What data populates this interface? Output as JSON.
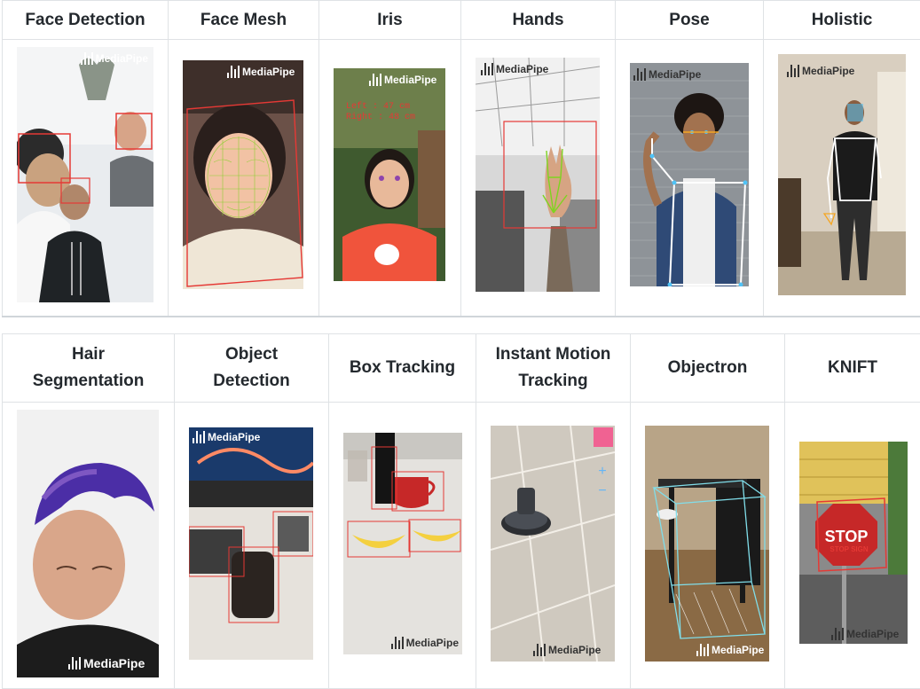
{
  "row1": {
    "headers": [
      "Face Detection",
      "Face Mesh",
      "Iris",
      "Hands",
      "Pose",
      "Holistic"
    ]
  },
  "row2": {
    "headers": [
      "Hair Segmentation",
      "Object Detection",
      "Box Tracking",
      "Instant Motion Tracking",
      "Objectron",
      "KNIFT"
    ]
  },
  "watermark": "MediaPipe",
  "iris_overlay": {
    "left": "Left : 47 cm",
    "right": "Right : 48 cm"
  },
  "knift_overlay": {
    "sign": "STOP",
    "match": "STOP SIGN"
  },
  "colors": {
    "border": "#dfe2e5",
    "accent_red": "#e53935",
    "accent_green": "#7ed321"
  }
}
